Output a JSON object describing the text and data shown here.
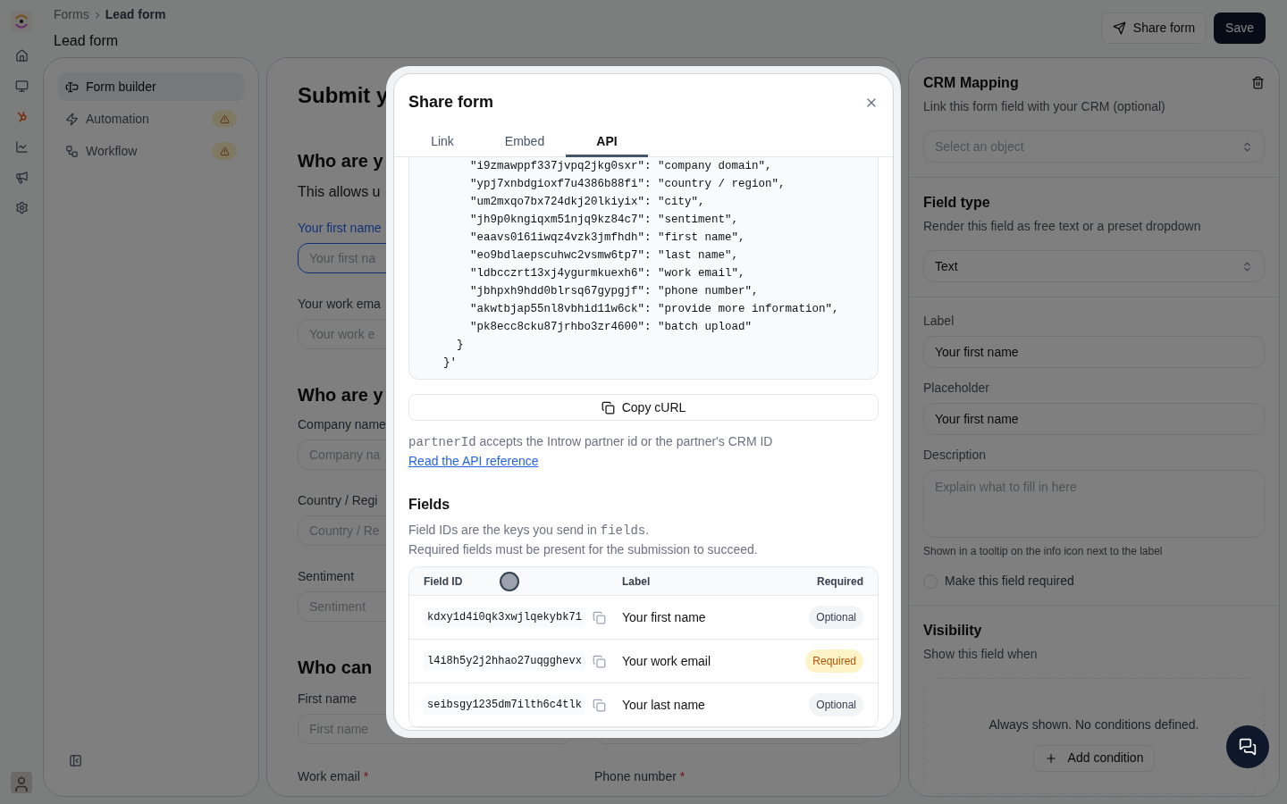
{
  "breadcrumb": [
    {
      "label": "Forms",
      "current": false
    },
    {
      "label": "Lead form",
      "current": true
    }
  ],
  "page_title": "Lead form",
  "header_buttons": [
    {
      "label": "Share form",
      "kind": "outline"
    },
    {
      "label": "Save",
      "kind": "primary"
    }
  ],
  "nav": [
    {
      "label": "Form builder",
      "selected": true,
      "warning": false
    },
    {
      "label": "Automation",
      "selected": false,
      "warning": true
    },
    {
      "label": "Workflow",
      "selected": false,
      "warning": true
    }
  ],
  "form_preview": {
    "title": "Submit y",
    "blocks": [
      {
        "kind": "heading",
        "text": "Who are y"
      },
      {
        "kind": "text",
        "text": "This allows u"
      },
      {
        "kind": "field",
        "label": "Your first name",
        "placeholder": "Your first na",
        "focused": true
      },
      {
        "kind": "field",
        "label": "Your work ema",
        "placeholder": "Your work e",
        "focused": false
      },
      {
        "kind": "heading",
        "text": "Who are y"
      },
      {
        "kind": "field",
        "label": "Company name",
        "placeholder": "Company na",
        "focused": false
      },
      {
        "kind": "field",
        "label": "Country / Regi",
        "placeholder": "Country / Re",
        "focused": false
      },
      {
        "kind": "field",
        "label": "Sentiment",
        "placeholder": "Sentiment",
        "focused": false
      },
      {
        "kind": "heading",
        "text": "Who can"
      }
    ],
    "grid_left": [
      {
        "kind": "field",
        "label": "First name",
        "placeholder": "First name",
        "focused": false
      },
      {
        "kind": "label",
        "label": "Work email",
        "marker": "*"
      }
    ],
    "grid_right": [
      {
        "kind": "blank"
      },
      {
        "kind": "label",
        "label": "Phone number",
        "marker": "*"
      }
    ]
  },
  "field_settings": {
    "sections": [
      {
        "title": "CRM Mapping",
        "subtitle": "Link this form field with your CRM (optional)",
        "select": {
          "placeholder": "Select an object"
        }
      },
      {
        "title": "Field type",
        "subtitle": "Render this field as free text or a preset dropdown",
        "select": {
          "value": "Text"
        }
      }
    ],
    "inputs": [
      {
        "label": "Label",
        "value": "Your first name"
      },
      {
        "label": "Placeholder",
        "value": "Your first name"
      }
    ],
    "description": {
      "label": "Description",
      "placeholder": "Explain what to fill in here",
      "hint": "Shown in a tooltip on the info icon next to the label"
    },
    "required_checkbox": {
      "label": "Make this field required",
      "checked": false
    },
    "visibility": {
      "title": "Visibility",
      "subtitle": "Show this field when",
      "empty": "Always shown. No conditions defined.",
      "button": "Add condition"
    }
  },
  "modal": {
    "title": "Share form",
    "tabs": [
      {
        "label": "Link",
        "selected": false
      },
      {
        "label": "Embed",
        "selected": false
      },
      {
        "label": "API",
        "selected": true
      }
    ],
    "code_lines": [
      "        \"i9zmawppf337jvpq2jkg0sxr\": \"company domain\",",
      "        \"ypj7xnbdgioxf7u4386b88fi\": \"country / region\",",
      "        \"um2mxqo7bx724dkj20lkiyix\": \"city\",",
      "        \"jh9p0kngiqxm51njq9kz84c7\": \"sentiment\",",
      "        \"eaavs0161iwqz4vzk3jmfhdh\": \"first name\",",
      "        \"eo9bdlaepscuhwc2vsmw6tp7\": \"last name\",",
      "        \"ldbcczrt13xj4ygurmkuexh6\": \"work email\",",
      "        \"jbhpxh9hdd0blrsq67gypgjf\": \"phone number\",",
      "        \"akwtbjap55nl8vbhid11w6ck\": \"provide more information\",",
      "        \"pk8ecc8cku87jrhbo3zr4600\": \"batch upload\"",
      "      }",
      "    }'"
    ],
    "copy_button": "Copy cURL",
    "note_code": "partnerId",
    "note": "accepts the Introw partner id or the partner's CRM ID",
    "link": "Read the API reference",
    "fields_title": "Fields",
    "fields_desc_before": "Field IDs are the keys you send in",
    "fields_desc_code": "fields",
    "fields_desc_after": ".",
    "fields_desc2": "Required fields must be present for the submission to succeed.",
    "columns": [
      "Field ID",
      "Label",
      "Required"
    ],
    "rows": [
      {
        "id": "kdxy1d4i0qk3xwjlqekybk71",
        "label": "Your first name",
        "required": false,
        "badge": "Optional"
      },
      {
        "id": "l4i8h5y2j2hhao27uqgghevx",
        "label": "Your work email",
        "required": true,
        "badge": "Required"
      },
      {
        "id": "seibsgy1235dm7ilth6c4tlk",
        "label": "Your last name",
        "required": false,
        "badge": "Optional"
      }
    ]
  }
}
